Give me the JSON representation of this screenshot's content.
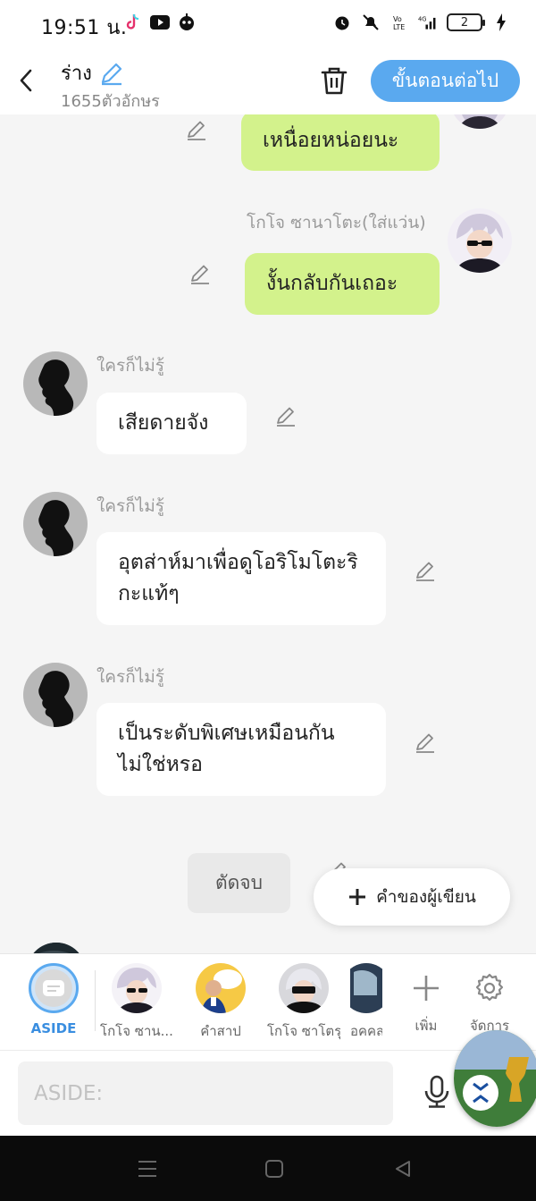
{
  "status_bar": {
    "time": "19:51 น.",
    "battery": "2"
  },
  "header": {
    "title": "ร่าง",
    "char_count": "1655ตัวอักษร",
    "next_label": "ขั้นตอนต่อไป"
  },
  "messages": [
    {
      "side": "right",
      "sender": "",
      "text": "เหนื่อยหน่อยนะ"
    },
    {
      "side": "right",
      "sender": "โกโจ ซานาโตะ(ใส่แว่น)",
      "text": "งั้นกลับกันเถอะ"
    },
    {
      "side": "left",
      "sender": "ใครก็ไม่รู้",
      "text": "เสียดายจัง"
    },
    {
      "side": "left",
      "sender": "ใครก็ไม่รู้",
      "text": "อุตส่าห์มาเพื่อดูโอริโมโตะริกะแท้ๆ"
    },
    {
      "side": "left",
      "sender": "ใครก็ไม่รู้",
      "text": "เป็นระดับพิเศษเหมือนกันไม่ใช่หรอ"
    }
  ],
  "actions": {
    "cut_label": "ตัดจบ",
    "author_label": "คำของผู้เขียน"
  },
  "characters": {
    "aside": "ASIDE",
    "items": [
      "โกโจ ซาน...",
      "คำสาป",
      "โกโจ ซาโตรุ",
      "อคคส"
    ],
    "add_label": "เพิ่ม",
    "manage_label": "จัดการ"
  },
  "input": {
    "placeholder": "ASIDE:"
  },
  "colors": {
    "accent": "#5aa9ef",
    "right_bubble": "#d3f28c",
    "left_bubble": "#ffffff"
  }
}
